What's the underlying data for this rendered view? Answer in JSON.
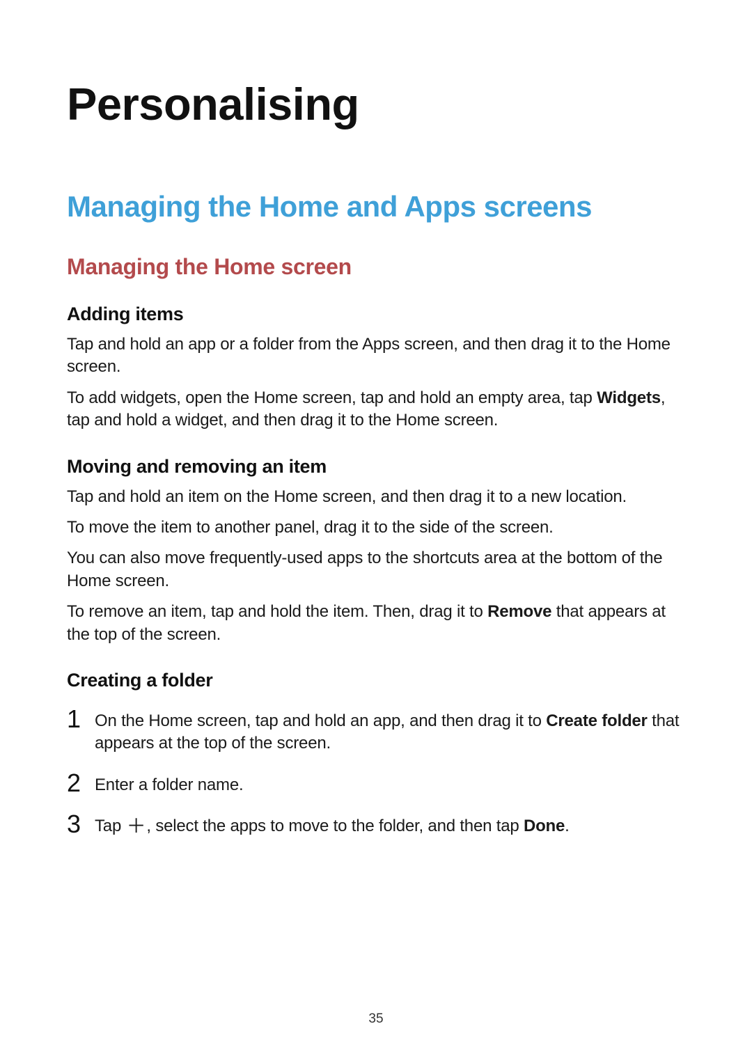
{
  "page_number": "35",
  "h1": "Personalising",
  "h2": "Managing the Home and Apps screens",
  "h3": "Managing the Home screen",
  "sec1": {
    "title": "Adding items",
    "p1": "Tap and hold an app or a folder from the Apps screen, and then drag it to the Home screen.",
    "p2a": "To add widgets, open the Home screen, tap and hold an empty area, tap ",
    "p2b": "Widgets",
    "p2c": ", tap and hold a widget, and then drag it to the Home screen."
  },
  "sec2": {
    "title": "Moving and removing an item",
    "p1": "Tap and hold an item on the Home screen, and then drag it to a new location.",
    "p2": "To move the item to another panel, drag it to the side of the screen.",
    "p3": "You can also move frequently-used apps to the shortcuts area at the bottom of the Home screen.",
    "p4a": "To remove an item, tap and hold the item. Then, drag it to ",
    "p4b": "Remove",
    "p4c": " that appears at the top of the screen."
  },
  "sec3": {
    "title": "Creating a folder",
    "n1": "1",
    "n2": "2",
    "n3": "3",
    "s1a": "On the Home screen, tap and hold an app, and then drag it to ",
    "s1b": "Create folder",
    "s1c": " that appears at the top of the screen.",
    "s2": "Enter a folder name.",
    "s3a": "Tap ",
    "s3b": ", select the apps to move to the folder, and then tap ",
    "s3c": "Done",
    "s3d": "."
  }
}
